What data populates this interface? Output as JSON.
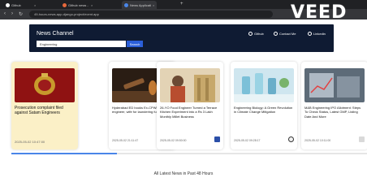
{
  "browser": {
    "tabs": [
      {
        "title": "Github",
        "color": "#ffffff"
      },
      {
        "title": "Github news - Overview - S",
        "color": "#e6683c"
      },
      {
        "title": "News Application",
        "color": "#4a86e8"
      }
    ],
    "new_tab": "+",
    "url": "49-hours-news-app-django-project/ecent.app",
    "nav": {
      "back": "‹",
      "forward": "›",
      "reload": "↻"
    }
  },
  "watermark": "VEED",
  "header": {
    "brand": "News Channel",
    "search_value": "Engineering",
    "search_button": "Search",
    "links": [
      "Github",
      "Contact Me",
      "Linkedin"
    ]
  },
  "cards": [
    {
      "title": "Prosecution complaint filed against Satam Engineers",
      "date": "2025-05-02 10:47:00",
      "highlight": true,
      "image": "emblem"
    },
    {
      "title": "Hyderabad ED books Ex-CPWD engineer, wife for laundering funds",
      "date": "2025-05-02 21:11:47",
      "highlight": false,
      "image": "gavel"
    },
    {
      "title": "26-YO Food Engineer Turned a Terrace Kitchen Experiment into a Rs 3 Lakh Monthly Millet Business",
      "date": "2025-05-02 09:50:00",
      "highlight": false,
      "image": "millet"
    },
    {
      "title": "Engineering Biology: A Green Revolution in Climate Change Mitigation",
      "date": "2025-05-02 09:28:17",
      "highlight": false,
      "image": "lab"
    },
    {
      "title": "M&B Engineering IPO Allotment: Steps To Check Status, Latest GMP, Listing Date And More",
      "date": "2025-05-02 10:11:00",
      "highlight": false,
      "image": "stocks"
    }
  ],
  "footer": "All Latest News in Past 48 Hours",
  "colors": {
    "header_bg": "#0f1b33",
    "search_button": "#2b5fd9",
    "highlight_card": "#fbf0c7",
    "scroll_thumb": "#4a86e8"
  }
}
